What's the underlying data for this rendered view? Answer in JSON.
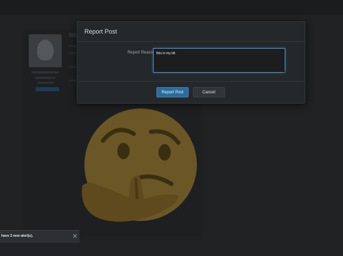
{
  "modal": {
    "title": "Report Post",
    "reason_label": "Report Reason:",
    "reason_value": "this is my bit",
    "submit_label": "Report Post",
    "cancel_label": "Cancel"
  },
  "alert": {
    "text": "have 3 new alert(s).",
    "close_glyph": "✕"
  },
  "colors": {
    "primary_button": "#2a6d9c",
    "focus_border": "#4c8fc2",
    "background": "#1c1e20"
  }
}
